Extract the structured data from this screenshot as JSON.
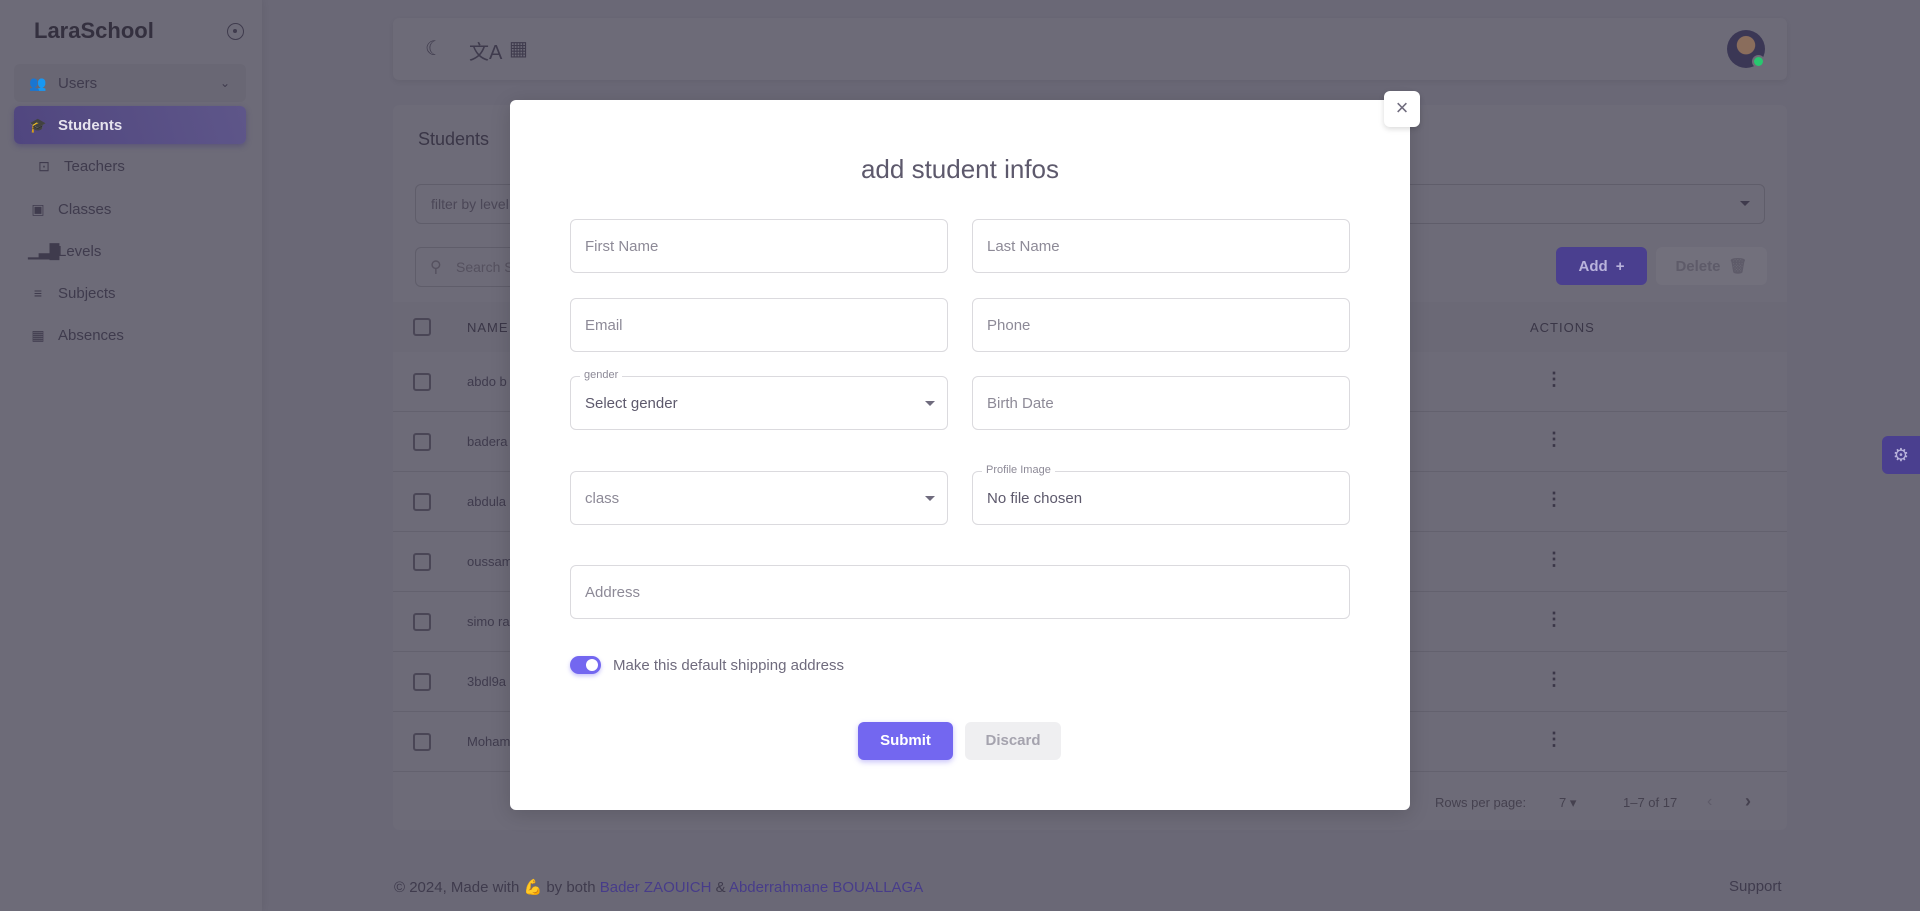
{
  "sidebar": {
    "brand": "LaraSchool",
    "items": [
      {
        "label": "Users",
        "icon": "users-icon"
      },
      {
        "label": "Students",
        "icon": "graduate-icon"
      },
      {
        "label": "Teachers",
        "icon": "teacher-icon"
      },
      {
        "label": "Classes",
        "icon": "classroom-icon"
      },
      {
        "label": "Levels",
        "icon": "bar-chart-icon"
      },
      {
        "label": "Subjects",
        "icon": "list-icon"
      },
      {
        "label": "Absences",
        "icon": "calendar-clock-icon"
      }
    ]
  },
  "header": {
    "icons": [
      "moon-icon",
      "translate-icon",
      "calendar-icon"
    ]
  },
  "students": {
    "title": "Students",
    "filter_placeholder": "filter by level",
    "search_placeholder": "Search Student",
    "add_label": "Add",
    "delete_label": "Delete",
    "columns": {
      "name": "NAME",
      "actions": "ACTIONS"
    },
    "rows": [
      "abdo b",
      "badera",
      "abdula",
      "oussam",
      "simo ra",
      "3bdl9a",
      "Moham"
    ],
    "rows_per_page_label": "Rows per page:",
    "rows_per_page": "7",
    "range": "1–7 of 17"
  },
  "footer": {
    "prefix": "© 2024, Made with",
    "by": "by both",
    "author1": "Bader ZAOUICH",
    "amp": "&",
    "author2": "Abderrahmane BOUALLAGA",
    "support": "Support"
  },
  "modal": {
    "title": "add student infos",
    "first_name": "First Name",
    "last_name": "Last Name",
    "email": "Email",
    "phone": "Phone",
    "gender_label": "gender",
    "gender_value": "Select gender",
    "birth_date": "Birth Date",
    "class": "class",
    "profile_label": "Profile Image",
    "profile_value": "No file chosen",
    "address": "Address",
    "toggle_label": "Make this default shipping address",
    "toggle_on": true,
    "submit": "Submit",
    "discard": "Discard"
  },
  "colors": {
    "primary": "#7367f0"
  }
}
